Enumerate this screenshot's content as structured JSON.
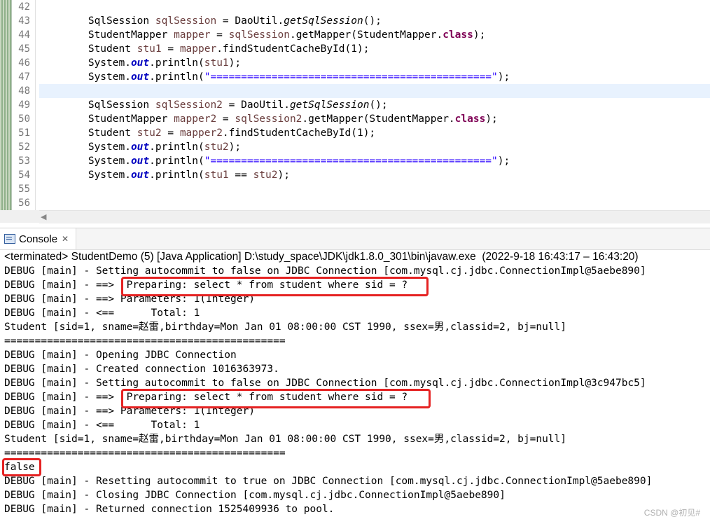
{
  "editor": {
    "line_numbers": [
      "42",
      "43",
      "44",
      "45",
      "46",
      "47",
      "48",
      "49",
      "50",
      "51",
      "52",
      "53",
      "54",
      "55",
      "56"
    ],
    "lines": [
      [],
      [
        {
          "t": "        SqlSession "
        },
        {
          "t": "sqlSession",
          "c": "var"
        },
        {
          "t": " = DaoUtil."
        },
        {
          "t": "getSqlSession",
          "c": "italic"
        },
        {
          "t": "();"
        }
      ],
      [
        {
          "t": "        StudentMapper "
        },
        {
          "t": "mapper",
          "c": "var"
        },
        {
          "t": " = "
        },
        {
          "t": "sqlSession",
          "c": "var"
        },
        {
          "t": ".getMapper(StudentMapper."
        },
        {
          "t": "class",
          "c": "kw"
        },
        {
          "t": ");"
        }
      ],
      [
        {
          "t": "        Student "
        },
        {
          "t": "stu1",
          "c": "var"
        },
        {
          "t": " = "
        },
        {
          "t": "mapper",
          "c": "var"
        },
        {
          "t": ".findStudentCacheById(1);"
        }
      ],
      [
        {
          "t": "        System."
        },
        {
          "t": "out",
          "c": "field"
        },
        {
          "t": ".println("
        },
        {
          "t": "stu1",
          "c": "var"
        },
        {
          "t": ");"
        }
      ],
      [
        {
          "t": "        System."
        },
        {
          "t": "out",
          "c": "field"
        },
        {
          "t": ".println("
        },
        {
          "t": "\"==============================================\"",
          "c": "str"
        },
        {
          "t": ");"
        }
      ],
      [],
      [
        {
          "t": "        SqlSession "
        },
        {
          "t": "sqlSession2",
          "c": "var"
        },
        {
          "t": " = DaoUtil."
        },
        {
          "t": "getSqlSession",
          "c": "italic"
        },
        {
          "t": "();"
        }
      ],
      [
        {
          "t": "        StudentMapper "
        },
        {
          "t": "mapper2",
          "c": "var"
        },
        {
          "t": " = "
        },
        {
          "t": "sqlSession2",
          "c": "var"
        },
        {
          "t": ".getMapper(StudentMapper."
        },
        {
          "t": "class",
          "c": "kw"
        },
        {
          "t": ");"
        }
      ],
      [
        {
          "t": "        Student "
        },
        {
          "t": "stu2",
          "c": "var"
        },
        {
          "t": " = "
        },
        {
          "t": "mapper2",
          "c": "var"
        },
        {
          "t": ".findStudentCacheById(1);"
        }
      ],
      [
        {
          "t": "        System."
        },
        {
          "t": "out",
          "c": "field"
        },
        {
          "t": ".println("
        },
        {
          "t": "stu2",
          "c": "var"
        },
        {
          "t": ");"
        }
      ],
      [
        {
          "t": "        System."
        },
        {
          "t": "out",
          "c": "field"
        },
        {
          "t": ".println("
        },
        {
          "t": "\"==============================================\"",
          "c": "str"
        },
        {
          "t": ");"
        }
      ],
      [
        {
          "t": "        System."
        },
        {
          "t": "out",
          "c": "field"
        },
        {
          "t": ".println("
        },
        {
          "t": "stu1",
          "c": "var"
        },
        {
          "t": " == "
        },
        {
          "t": "stu2",
          "c": "var"
        },
        {
          "t": ");"
        }
      ],
      [],
      []
    ],
    "highlighted_line_index": 6,
    "colors": {
      "variable": "#6a3e3e",
      "keyword": "#7f0055",
      "field": "#0000c0",
      "string": "#2a00ff",
      "highlight": "#e8f2fe"
    }
  },
  "console": {
    "tab_label": "Console",
    "tab_icon": "console-icon",
    "close_icon": "close-icon",
    "status": "<terminated> StudentDemo (5) [Java Application] D:\\study_space\\JDK\\jdk1.8.0_301\\bin\\javaw.exe  (2022-9-18 16:43:17 – 16:43:20)",
    "lines": [
      "DEBUG [main] - Setting autocommit to false on JDBC Connection [com.mysql.cj.jdbc.ConnectionImpl@5aebe890]",
      "DEBUG [main] - ==>  Preparing: select * from student where sid = ?",
      "DEBUG [main] - ==> Parameters: 1(Integer)",
      "DEBUG [main] - <==      Total: 1",
      "Student [sid=1, sname=赵雷,birthday=Mon Jan 01 08:00:00 CST 1990, ssex=男,classid=2, bj=null]",
      "==============================================",
      "DEBUG [main] - Opening JDBC Connection",
      "DEBUG [main] - Created connection 1016363973.",
      "DEBUG [main] - Setting autocommit to false on JDBC Connection [com.mysql.cj.jdbc.ConnectionImpl@3c947bc5]",
      "DEBUG [main] - ==>  Preparing: select * from student where sid = ?",
      "DEBUG [main] - ==> Parameters: 1(Integer)",
      "DEBUG [main] - <==      Total: 1",
      "Student [sid=1, sname=赵雷,birthday=Mon Jan 01 08:00:00 CST 1990, ssex=男,classid=2, bj=null]",
      "==============================================",
      "false",
      "DEBUG [main] - Resetting autocommit to true on JDBC Connection [com.mysql.cj.jdbc.ConnectionImpl@5aebe890]",
      "DEBUG [main] - Closing JDBC Connection [com.mysql.cj.jdbc.ConnectionImpl@5aebe890]",
      "DEBUG [main] - Returned connection 1525409936 to pool."
    ],
    "annotation_color": "#e52222"
  },
  "watermark": "CSDN @初见#"
}
